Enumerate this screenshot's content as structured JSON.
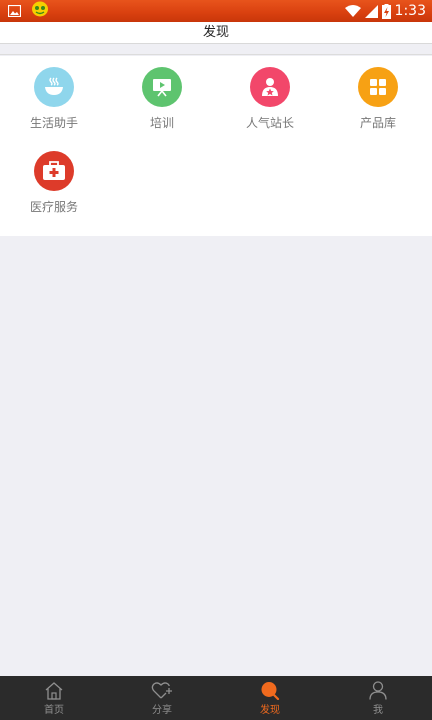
{
  "status_bar": {
    "time": "1:33",
    "notification_icons": [
      "image-icon",
      "game-icon"
    ],
    "indicators": [
      "wifi-icon",
      "signal-icon",
      "battery-charging-icon"
    ]
  },
  "header": {
    "title": "发现"
  },
  "grid": [
    {
      "label": "生活助手",
      "icon": "bowl-icon",
      "color": "#8fd6ec"
    },
    {
      "label": "培训",
      "icon": "presentation-icon",
      "color": "#5ec46f"
    },
    {
      "label": "人气站长",
      "icon": "star-user-icon",
      "color": "#f2476a"
    },
    {
      "label": "产品库",
      "icon": "grid-icon",
      "color": "#f7a114"
    },
    {
      "label": "医疗服务",
      "icon": "medkit-icon",
      "color": "#dd3b2a"
    }
  ],
  "bottom_nav": {
    "tabs": [
      {
        "label": "首页",
        "icon": "home-icon",
        "active": false
      },
      {
        "label": "分享",
        "icon": "heart-plus-icon",
        "active": false
      },
      {
        "label": "发现",
        "icon": "discover-icon",
        "active": true
      },
      {
        "label": "我",
        "icon": "person-icon",
        "active": false
      }
    ],
    "active_color": "#f06a1e",
    "inactive_color": "#8f8f8f"
  },
  "colors": {
    "status_bar": "#d9400f",
    "background": "#efeff4",
    "nav_background": "#2b2b2b"
  }
}
